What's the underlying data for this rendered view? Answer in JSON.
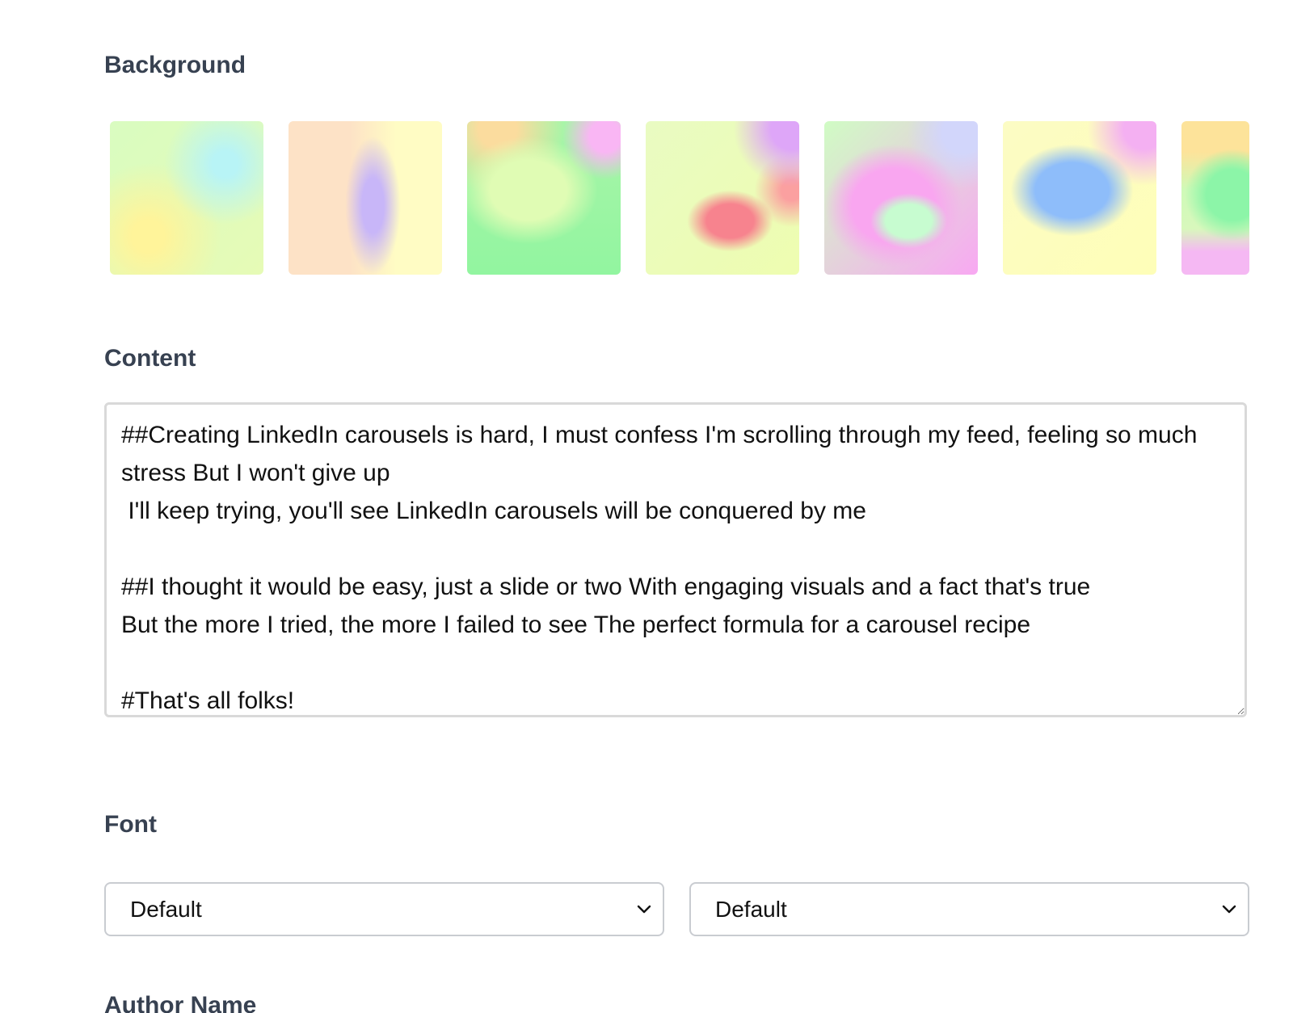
{
  "sections": {
    "background_label": "Background",
    "content_label": "Content",
    "font_label": "Font",
    "author_label": "Author Name"
  },
  "backgrounds": [
    {
      "name": "gradient-1",
      "colors": [
        "#d9fcc0",
        "#b8f4f6",
        "#fff49a"
      ]
    },
    {
      "name": "gradient-2",
      "colors": [
        "#fde2c6",
        "#c8b6f8",
        "#fffcc4"
      ]
    },
    {
      "name": "gradient-3",
      "colors": [
        "#fbdc9e",
        "#e0fcb4",
        "#92f5a0",
        "#f9b6f4"
      ]
    },
    {
      "name": "gradient-4",
      "colors": [
        "#e9fbc2",
        "#f7838e",
        "#dea6f8"
      ]
    },
    {
      "name": "gradient-5",
      "colors": [
        "#d0fcc4",
        "#f9a6f0",
        "#c7fcd0",
        "#d2d6fb"
      ]
    },
    {
      "name": "gradient-6",
      "colors": [
        "#fcfcc4",
        "#8ebdfa",
        "#f4b0f2"
      ]
    },
    {
      "name": "gradient-7",
      "colors": [
        "#fde39a",
        "#8cf5a8",
        "#f5b8f3"
      ]
    }
  ],
  "content": {
    "text": "##Creating LinkedIn carousels is hard, I must confess I'm scrolling through my feed, feeling so much stress But I won't give up\n I'll keep trying, you'll see LinkedIn carousels will be conquered by me\n\n##I thought it would be easy, just a slide or two With engaging visuals and a fact that's true\nBut the more I tried, the more I failed to see The perfect formula for a carousel recipe\n\n#That's all folks!"
  },
  "font": {
    "family_select": {
      "value": "Default"
    },
    "style_select": {
      "value": "Default"
    }
  },
  "icons": {
    "select_chevron": "chevron-down-icon",
    "resize_handle": "resize-handle-icon"
  }
}
